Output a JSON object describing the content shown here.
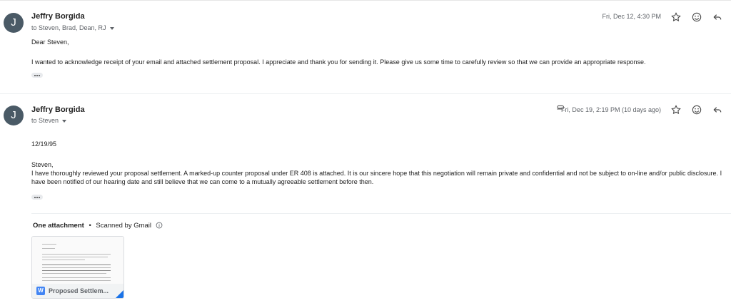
{
  "messages": [
    {
      "avatar": "J",
      "sender": "Jeffry Borgida",
      "to": "to Steven, Brad, Dean, RJ",
      "date": "Fri, Dec 12, 4:30 PM",
      "greeting": "Dear Steven,",
      "body": "I wanted to acknowledge receipt of your email and attached settlement proposal.  I appreciate and thank you for sending it.  Please give us some time to carefully review so that we can provide an appropriate response."
    },
    {
      "avatar": "J",
      "sender": "Jeffry Borgida",
      "to": "to Steven",
      "date": "Fri, Dec 19, 2:19 PM (10 days ago)",
      "dateline": "12/19/95",
      "greeting": "Steven,",
      "body": "I have thoroughly reviewed your proposal settlement.  A marked-up counter proposal under ER 408 is attached.  It is our sincere hope that this negotiation will remain private and confidential and not be subject to on-line and/or public disclosure.  I have been notified of our hearing date and still believe that we can come to a mutually agreeable settlement before then."
    }
  ],
  "attachments": {
    "title": "One attachment",
    "separator": "•",
    "scanned": "Scanned by Gmail",
    "info_icon": "info-icon",
    "file": {
      "name": "Proposed Settlem...",
      "type_badge": "W",
      "icon": "word-doc-icon"
    }
  },
  "icons": [
    "star-icon",
    "emoji-icon",
    "reply-icon",
    "paperclip-icon",
    "chevron-down-icon",
    "more-dots-icon"
  ],
  "colors": {
    "avatar": "#4a5a66",
    "word_blue": "#4285f4",
    "corner_blue": "#1a73e8"
  }
}
